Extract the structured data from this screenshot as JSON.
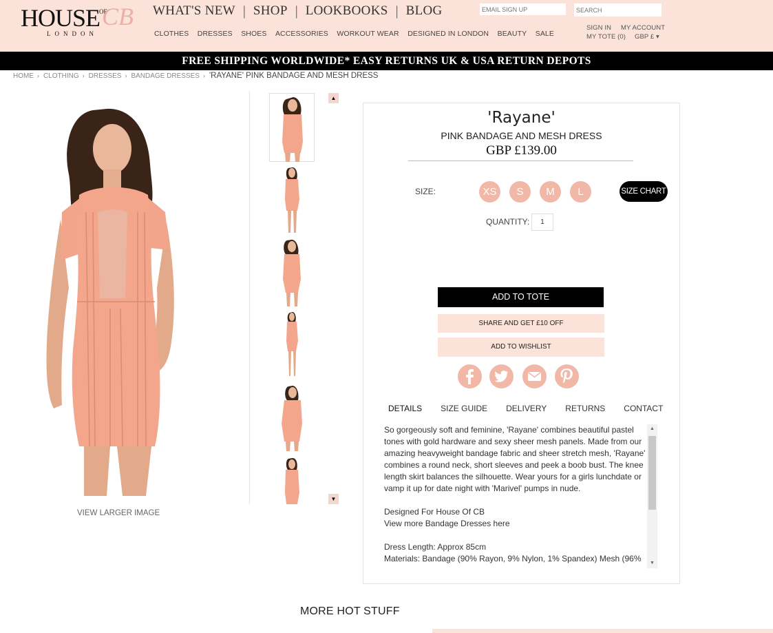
{
  "header": {
    "logo": {
      "main": "HOUSE",
      "of": "OF",
      "cb": "CB",
      "sub": "LONDON"
    },
    "main_nav": [
      {
        "label": "WHAT'S NEW"
      },
      {
        "label": "SHOP"
      },
      {
        "label": "LOOKBOOKS"
      },
      {
        "label": "BLOG"
      }
    ],
    "sub_nav": [
      {
        "label": "CLOTHES"
      },
      {
        "label": "DRESSES"
      },
      {
        "label": "SHOES"
      },
      {
        "label": "ACCESSORIES"
      },
      {
        "label": "WORKOUT WEAR"
      },
      {
        "label": "DESIGNED IN LONDON"
      },
      {
        "label": "BEAUTY"
      },
      {
        "label": "SALE"
      }
    ],
    "email_signup_placeholder": "EMAIL SIGN UP",
    "search_placeholder": "SEARCH",
    "sign_in": "SIGN IN",
    "my_account": "MY ACCOUNT",
    "my_tote": "MY TOTE (0)",
    "currency": "GBP £ ▾"
  },
  "promo_text": "FREE SHIPPING WORLDWIDE* EASY RETURNS UK & USA RETURN DEPOTS",
  "breadcrumb": {
    "items": [
      {
        "label": "HOME"
      },
      {
        "label": "CLOTHING"
      },
      {
        "label": "DRESSES"
      },
      {
        "label": "BANDAGE DRESSES"
      }
    ],
    "separator": "›",
    "current": "'RAYANE' PINK BANDAGE AND MESH DRESS"
  },
  "gallery": {
    "view_larger": "VIEW LARGER IMAGE",
    "thumbnail_count": 6,
    "up_arrow": "▲",
    "down_arrow": "▼"
  },
  "product": {
    "name": "'Rayane'",
    "subtitle": "PINK BANDAGE AND MESH DRESS",
    "price": "GBP £139.00",
    "size_label": "SIZE:",
    "sizes": [
      "XS",
      "S",
      "M",
      "L"
    ],
    "size_chart": "SIZE CHART",
    "quantity_label": "QUANTITY:",
    "quantity": "1",
    "add_to_tote": "ADD TO TOTE",
    "share": "SHARE AND GET £10 OFF",
    "wishlist": "ADD TO WISHLIST",
    "social_icons": [
      "facebook-icon",
      "twitter-icon",
      "email-icon",
      "pinterest-icon"
    ],
    "tabs": [
      {
        "label": "DETAILS",
        "active": true
      },
      {
        "label": "SIZE GUIDE"
      },
      {
        "label": "DELIVERY"
      },
      {
        "label": "RETURNS"
      },
      {
        "label": "CONTACT"
      }
    ],
    "description": {
      "paragraph1": "So gorgeously soft and feminine, 'Rayane' combines beautiful pastel tones with gold hardware and sexy sheer mesh panels. Made from our amazing heavyweight bandage fabric and sheer stretch mesh, 'Rayane' combines a round neck, short sleeves and peek a boob bust. The knee length skirt balances the silhouette. Wear yours for a girls lunchdate or vamp it up for date night with 'Marivel' pumps in nude.",
      "designed": "Designed For House Of CB",
      "view_more": "View more Bandage Dresses here",
      "dress_length": "Dress Length: Approx 85cm",
      "materials": "Materials: Bandage (90% Rayon, 9% Nylon, 1% Spandex) Mesh (96%"
    }
  },
  "more_hot_stuff": "MORE HOT STUFF",
  "colors": {
    "header_bg": "#fbe3da",
    "accent_pink": "#f1b8a8",
    "black": "#000000"
  }
}
